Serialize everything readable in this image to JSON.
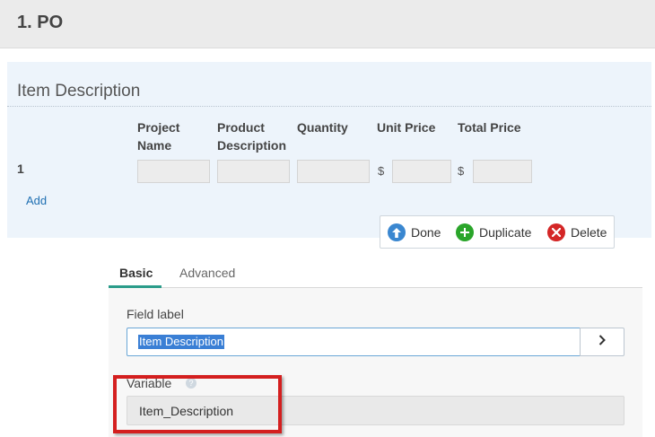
{
  "header": {
    "title": "1. PO"
  },
  "section": {
    "title": "Item Description"
  },
  "table": {
    "columns": [
      "Project\nName",
      "Product\nDescription",
      "Quantity",
      "Unit Price",
      "Total Price"
    ],
    "row_number": "1",
    "currency_symbol": "$",
    "add_label": "Add"
  },
  "toolbar": {
    "done_label": "Done",
    "duplicate_label": "Duplicate",
    "delete_label": "Delete"
  },
  "tabs": {
    "basic": "Basic",
    "advanced": "Advanced"
  },
  "field": {
    "label": "Field label",
    "value": "Item Description"
  },
  "variable": {
    "label": "Variable",
    "value": "Item_Description"
  },
  "icons": {
    "done": "arrow-up-circle-icon",
    "duplicate": "plus-circle-icon",
    "delete": "x-circle-icon",
    "arrow": "chevron-right-icon",
    "help": "question-icon"
  },
  "colors": {
    "done": "#3a87d0",
    "duplicate": "#2aa52a",
    "delete": "#d42626",
    "highlight": "#d41f1f",
    "tab_accent": "#2b9c8a"
  }
}
